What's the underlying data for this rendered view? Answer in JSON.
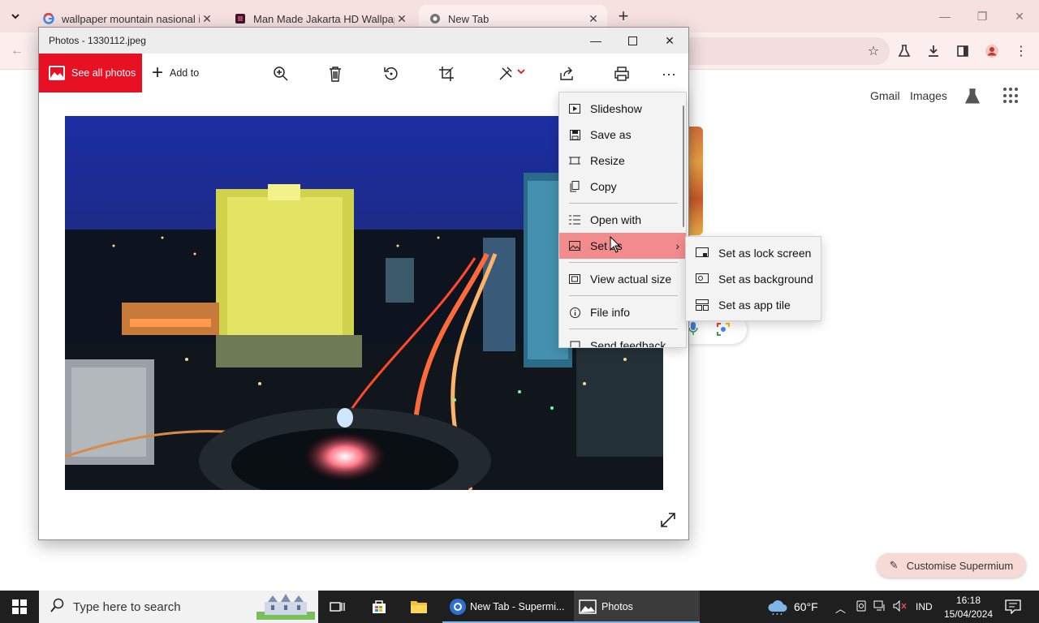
{
  "browser": {
    "tabs": [
      {
        "title": "wallpaper mountain nasional i",
        "favicon": "google-g-icon"
      },
      {
        "title": "Man Made Jakarta HD Wallpap",
        "favicon": "site-favicon-icon"
      },
      {
        "title": "New Tab",
        "favicon": "chrome-icon",
        "active": true
      }
    ],
    "ntp": {
      "gmail": "Gmail",
      "images": "Images",
      "customise": "Customise Supermium"
    }
  },
  "photos": {
    "window_title": "Photos - 1330112.jpeg",
    "toolbar": {
      "see_all": "See all photos",
      "add_to": "Add to"
    },
    "context_menu": {
      "items": [
        "Slideshow",
        "Save as",
        "Resize",
        "Copy",
        "Open with",
        "Set as",
        "View actual size",
        "File info",
        "Send feedback"
      ],
      "highlighted": "Set as"
    },
    "submenu": {
      "items": [
        "Set as lock screen",
        "Set as background",
        "Set as app tile"
      ]
    }
  },
  "taskbar": {
    "search_placeholder": "Type here to search",
    "apps": [
      {
        "label": "New Tab - Supermi..."
      },
      {
        "label": "Photos"
      }
    ],
    "weather": "60°F",
    "language": "IND",
    "time": "16:18",
    "date": "15/04/2024"
  },
  "colors": {
    "accent_red": "#e81123",
    "menu_highlight": "#f28c8c",
    "tab_bar": "#f6e1e0"
  }
}
